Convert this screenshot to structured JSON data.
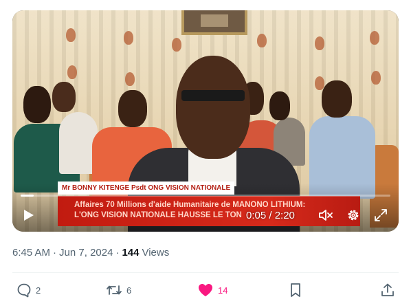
{
  "video": {
    "lower_third_name": "Mr BONNY KITENGE  Psdt ONG VISION NATIONALE",
    "headline_line1": "Affaires 70 Millions d'aide Humanitaire de MANONO LITHIUM:",
    "headline_line2": "L'ONG VISION NATIONALE HAUSSE LE TON",
    "time_display": "0:05 / 2:20",
    "progress": 0.036,
    "icons": [
      "play-icon",
      "mute-icon",
      "settings-icon",
      "fullscreen-icon"
    ]
  },
  "meta": {
    "time": "6:45 AM",
    "separator": "·",
    "date": "Jun 7, 2024",
    "views_count": "144",
    "views_label": "Views"
  },
  "actions": {
    "replies": "2",
    "reposts": "6",
    "likes": "14",
    "like_color": "#f91880",
    "icons": [
      "reply-icon",
      "repost-icon",
      "heart-icon",
      "bookmark-icon",
      "share-icon"
    ]
  }
}
